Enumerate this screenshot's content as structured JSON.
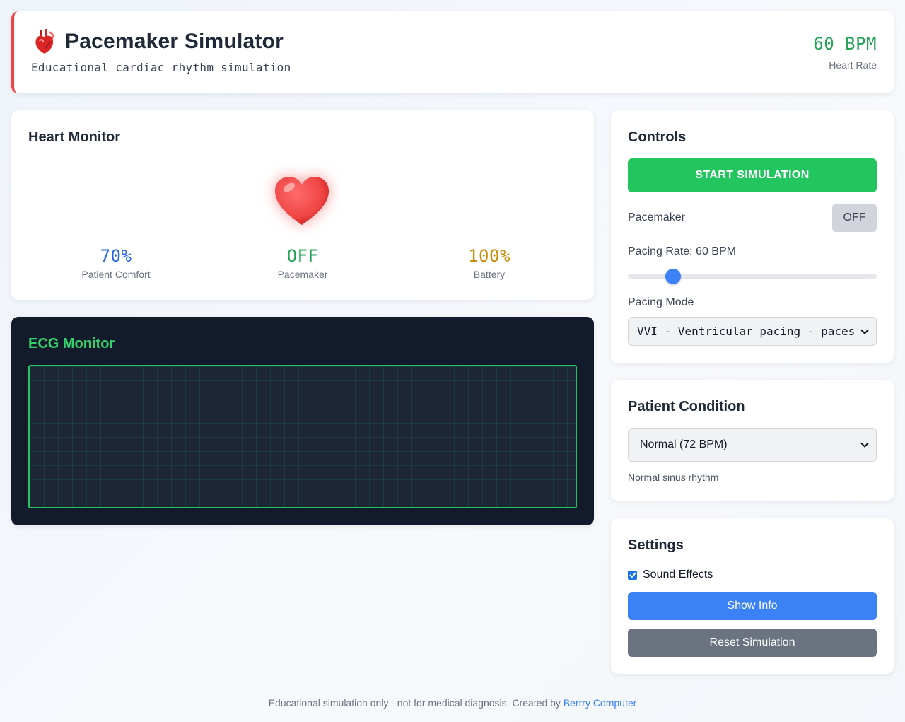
{
  "header": {
    "title": "Pacemaker Simulator",
    "subtitle": "Educational cardiac rhythm simulation",
    "heart_rate": "60 BPM",
    "heart_rate_label": "Heart Rate",
    "icon": "anatomical-heart-icon"
  },
  "monitor": {
    "title": "Heart Monitor",
    "icon": "heart-icon",
    "stats": {
      "comfort_value": "70%",
      "comfort_label": "Patient Comfort",
      "pacemaker_value": "OFF",
      "pacemaker_label": "Pacemaker",
      "battery_value": "100%",
      "battery_label": "Battery"
    }
  },
  "ecg": {
    "title": "ECG Monitor"
  },
  "controls": {
    "title": "Controls",
    "start_label": "START SIMULATION",
    "pacemaker_label": "Pacemaker",
    "pacemaker_toggle": "OFF",
    "pacing_rate_label": "Pacing Rate: 60 BPM",
    "pacing_rate_fraction": 0.16,
    "pacing_mode_label": "Pacing Mode",
    "pacing_mode_value": "VVI - Ventricular pacing - paces"
  },
  "patient": {
    "title": "Patient Condition",
    "condition_value": "Normal (72 BPM)",
    "description": "Normal sinus rhythm"
  },
  "settings": {
    "title": "Settings",
    "sound_label": "Sound Effects",
    "sound_checked": true,
    "show_info_label": "Show Info",
    "reset_label": "Reset Simulation"
  },
  "footer": {
    "text": "Educational simulation only - not for medical diagnosis. Created by",
    "link_text": "Berrry Computer"
  },
  "colors": {
    "accent_red": "#ef4444",
    "green": "#22c55e",
    "blue": "#3b82f6",
    "gray": "#6b7280",
    "ecg_bg": "#131a2b"
  }
}
